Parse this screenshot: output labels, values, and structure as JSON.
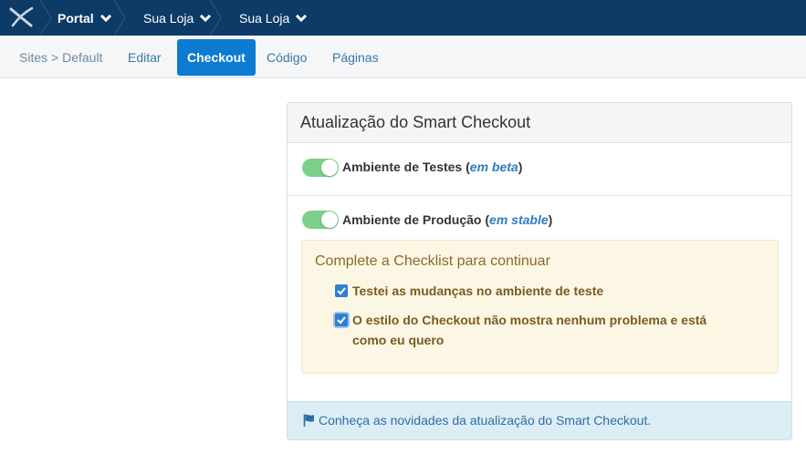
{
  "topbar": {
    "logo_icon": "x-logo-icon",
    "crumbs": [
      {
        "label": "Portal"
      },
      {
        "label": "Sua Loja"
      },
      {
        "label": "Sua Loja"
      }
    ]
  },
  "subnav": {
    "items": [
      {
        "label": "Sites > Default"
      },
      {
        "label": "Editar"
      },
      {
        "label": "Checkout",
        "active": true
      },
      {
        "label": "Código"
      },
      {
        "label": "Páginas"
      }
    ]
  },
  "panel": {
    "title": "Atualização do Smart Checkout",
    "test_env": {
      "label": "Ambiente de Testes (",
      "tag": "em beta",
      "close": ")",
      "enabled": true
    },
    "prod_env": {
      "label": "Ambiente de Produção (",
      "tag": "em stable",
      "close": ")",
      "enabled": true
    },
    "checklist": {
      "title": "Complete a Checklist para continuar",
      "items": [
        {
          "label": "Testei as mudanças no ambiente de teste",
          "checked": true
        },
        {
          "label_line1": "O estilo do Checkout não mostra nenhum problema e está",
          "label_line2": "como eu quero",
          "checked": true
        }
      ]
    },
    "footer_link": "Conheça as novidades da atualização do Smart Checkout."
  },
  "colors": {
    "topbar": "#0e3a66",
    "active_tab": "#0c7bd1",
    "toggle_on": "#7dd08a",
    "checklist_bg": "#fcf7e4",
    "footer_bg": "#dcedf5"
  }
}
